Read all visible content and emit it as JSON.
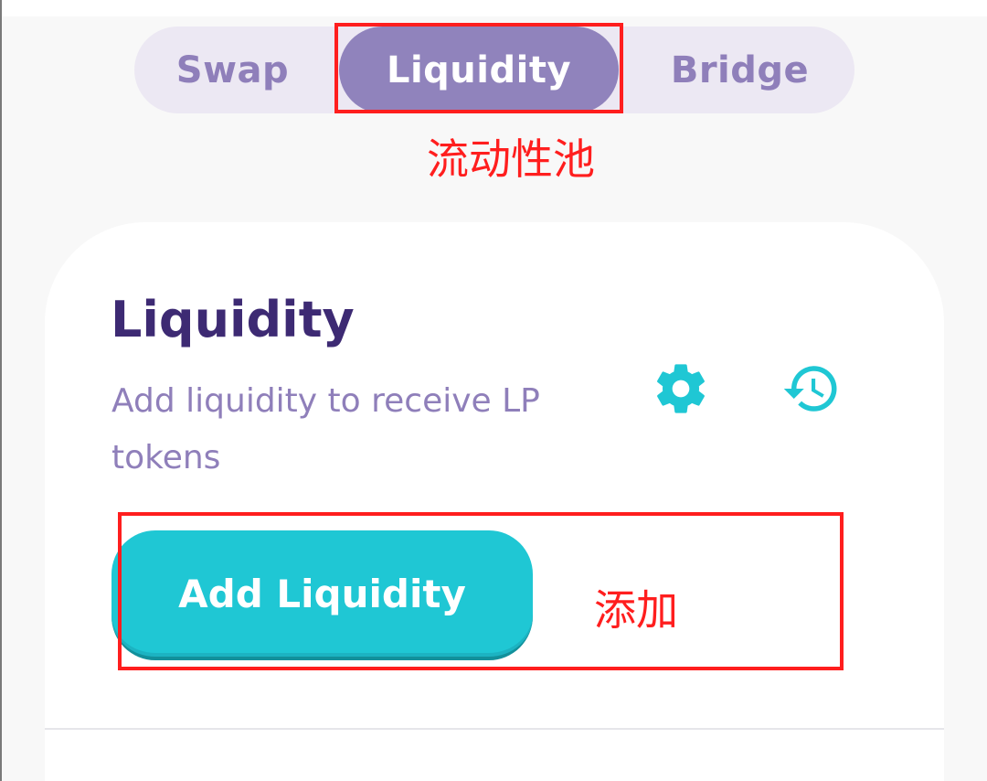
{
  "tabs": [
    {
      "label": "Swap",
      "active": false
    },
    {
      "label": "Liquidity",
      "active": true
    },
    {
      "label": "Bridge",
      "active": false
    }
  ],
  "card": {
    "title": "Liquidity",
    "subtitle": "Add liquidity to receive LP tokens",
    "add_button_label": "Add Liquidity"
  },
  "icons": {
    "settings": "gear-icon",
    "history": "history-icon"
  },
  "annotations": {
    "tab_note": "流动性池",
    "add_note": "添加"
  },
  "colors": {
    "accent": "#1fc7d4",
    "tab_active": "#9083bc",
    "tab_inactive_text": "#8f7fba",
    "title": "#3d2a73",
    "annotation": "#ff1e1e"
  }
}
